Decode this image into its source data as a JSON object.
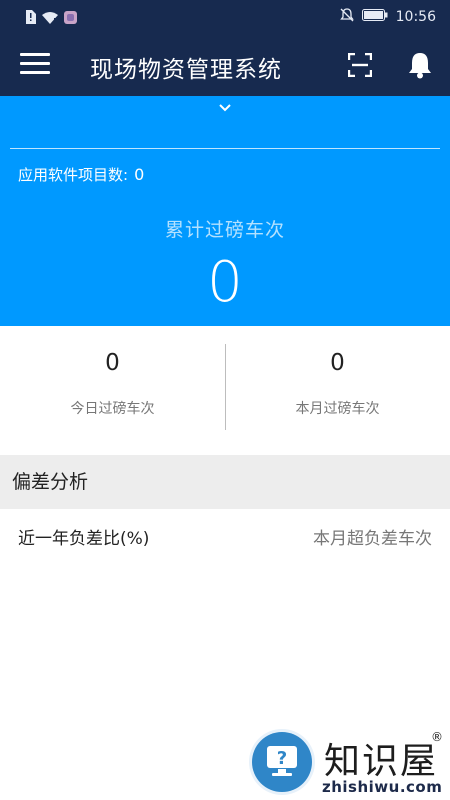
{
  "status_bar": {
    "time": "10:56",
    "left_icons": [
      "sim-alert-icon",
      "wifi-icon",
      "app-notification-icon"
    ],
    "right_icons": [
      "mute-icon",
      "battery-icon"
    ]
  },
  "app_bar": {
    "title": "现场物资管理系统",
    "icons": [
      "menu-icon",
      "scan-icon",
      "bell-icon"
    ],
    "color": "#172a4f"
  },
  "hero": {
    "accent": "#0099ff",
    "project_count_label": "应用软件项目数:",
    "project_count_value": "0",
    "cumulative_label": "累计过磅车次",
    "cumulative_value": "0"
  },
  "stats": {
    "today": {
      "value": "0",
      "label": "今日过磅车次"
    },
    "month": {
      "value": "0",
      "label": "本月过磅车次"
    }
  },
  "deviation": {
    "section_title": "偏差分析",
    "left_label": "近一年负差比(%)",
    "right_label": "本月超负差车次"
  },
  "watermark": {
    "brand_text": "知识屋",
    "registered": "®",
    "site": "zhishiwu.com"
  }
}
